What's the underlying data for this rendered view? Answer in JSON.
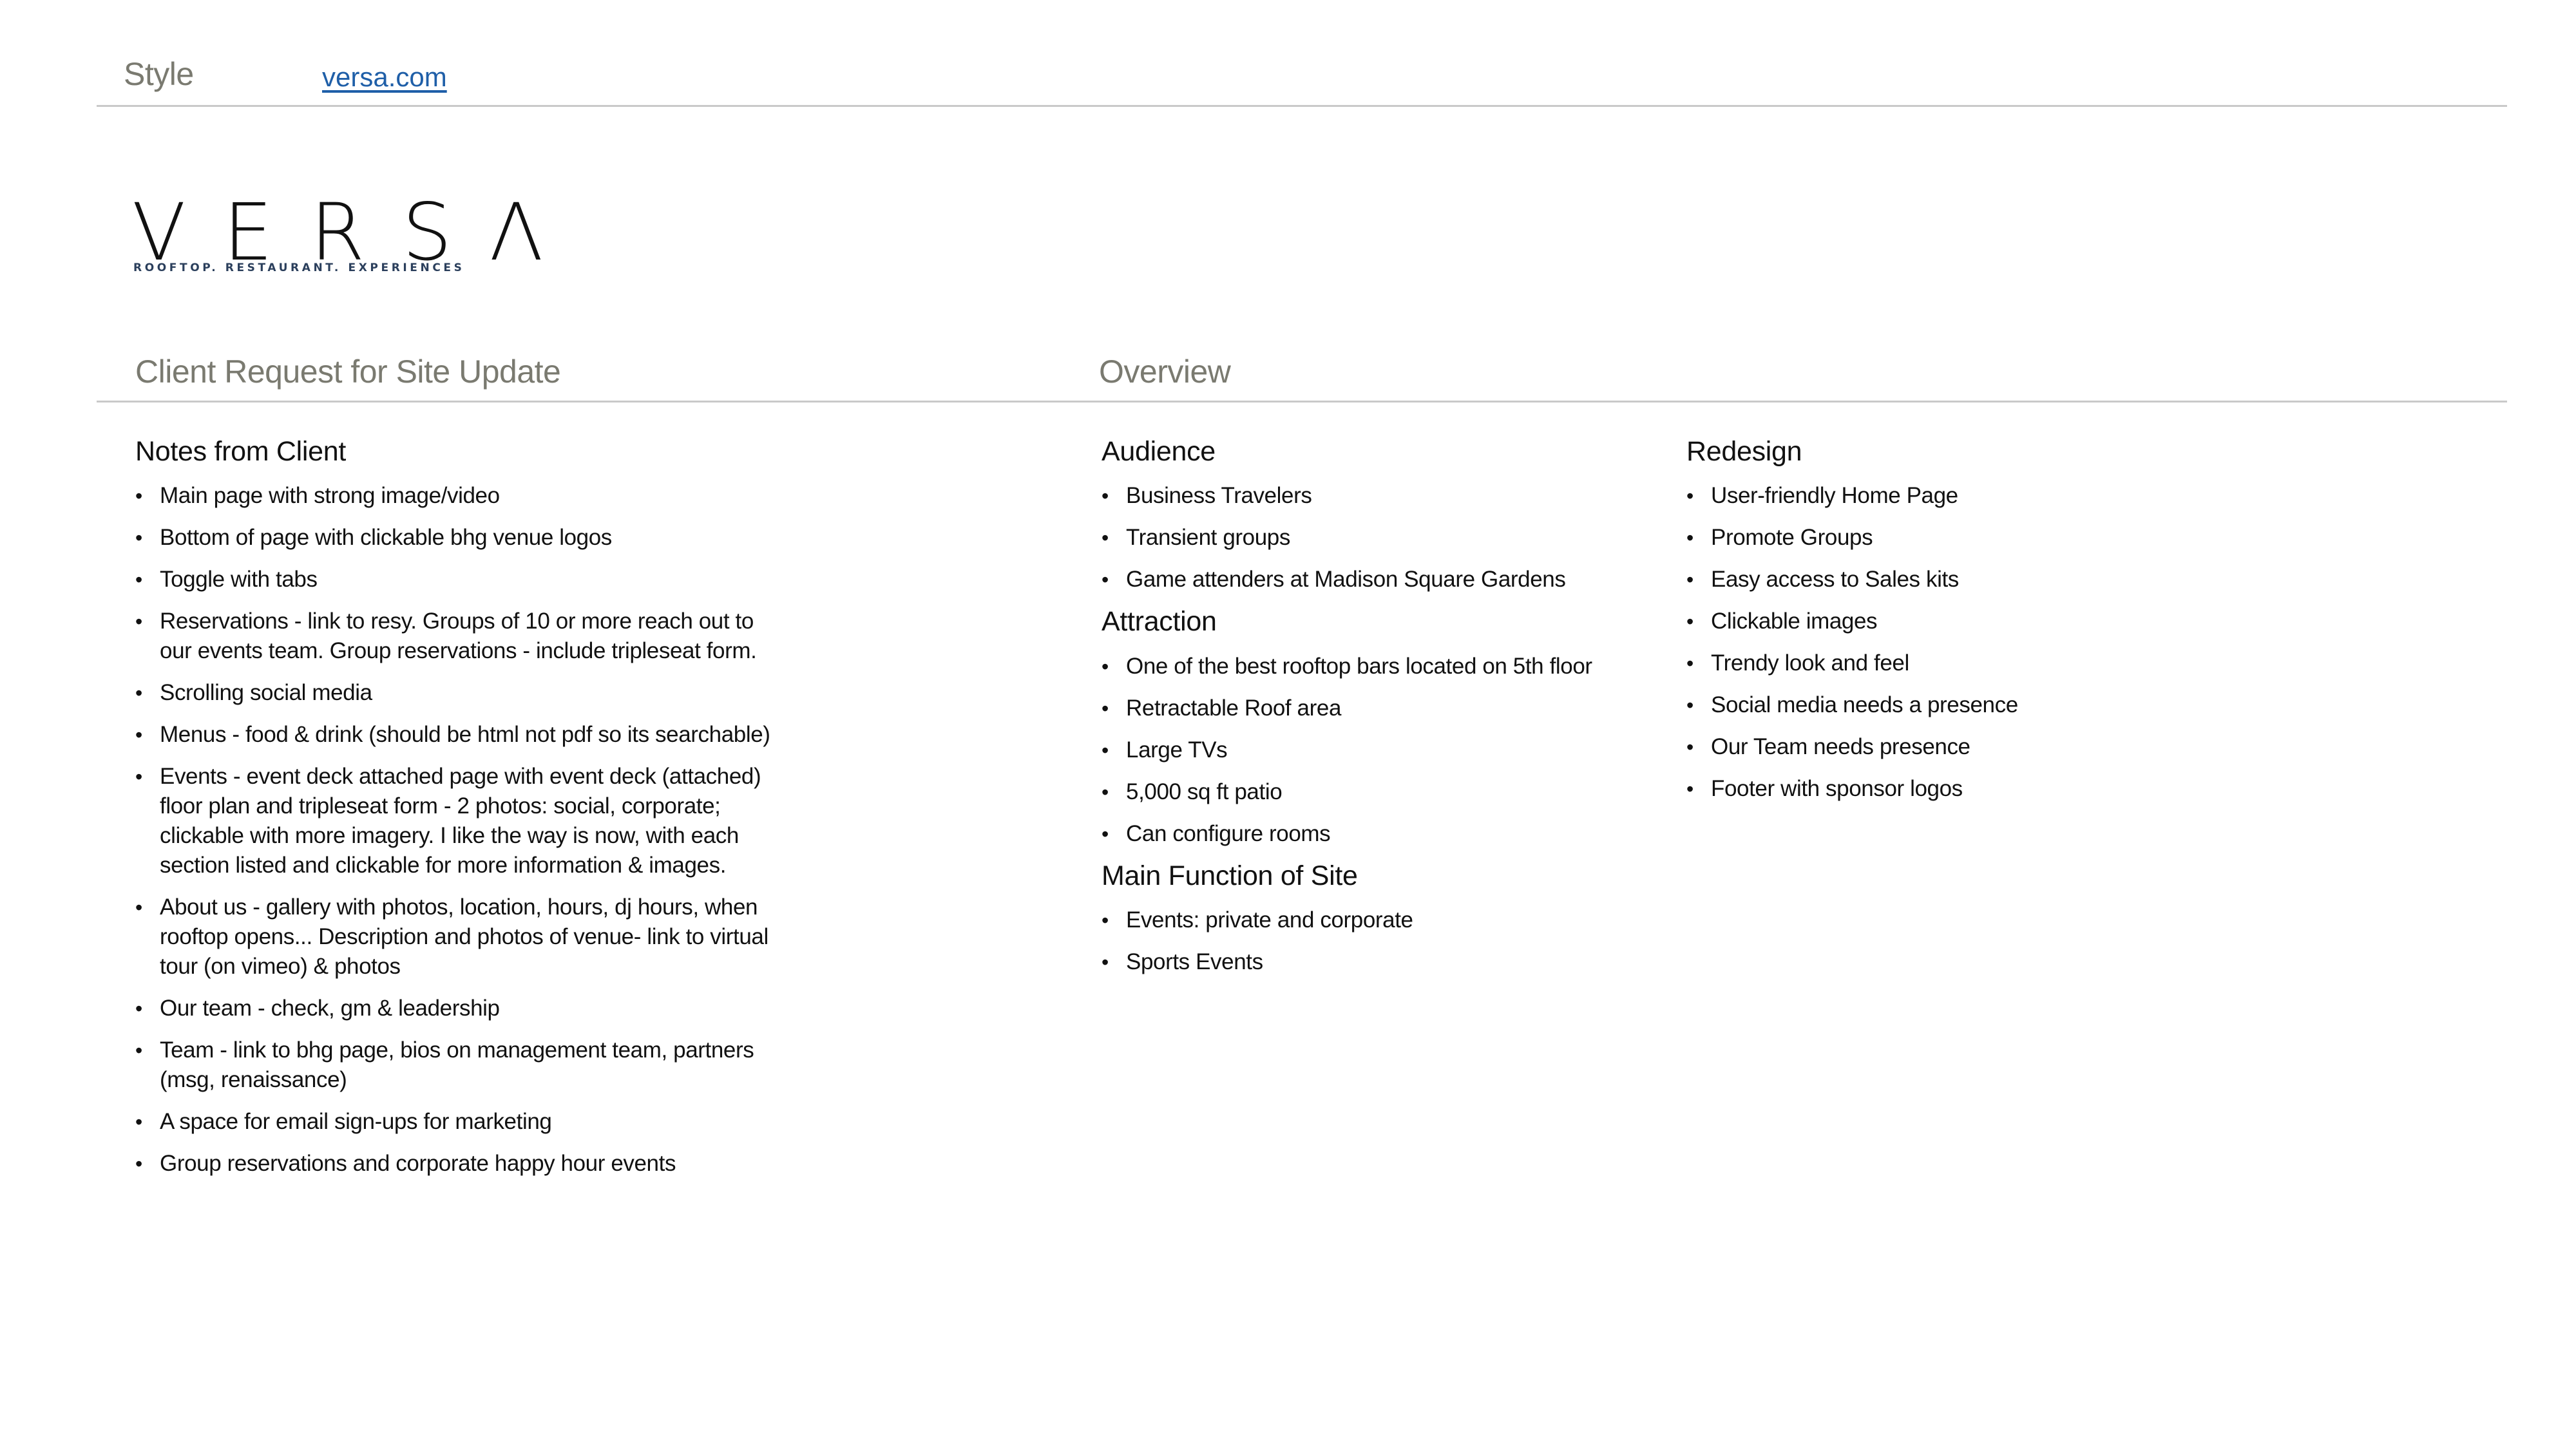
{
  "header": {
    "style_label": "Style",
    "site_link": "versa.com",
    "link_color": "#1f5fa8"
  },
  "logo": {
    "wordmark": "VERSΛ",
    "tagline": "ROOFTOP.  RESTAURANT.  EXPERIENCES",
    "tagline_color": "#2b3f5c"
  },
  "sections": {
    "left_title": "Client Request for Site Update",
    "right_title": "Overview"
  },
  "notes": {
    "heading": "Notes from Client",
    "items": [
      "Main page with strong image/video",
      "Bottom of page with clickable bhg venue logos",
      "Toggle with tabs",
      "Reservations - link to resy. Groups of 10 or more reach out to our events team. Group reservations - include tripleseat form.",
      "Scrolling social media",
      "Menus - food & drink (should be html not pdf so its searchable)",
      "Events - event deck attached page with event deck (attached) floor plan and tripleseat form - 2 photos: social, corporate; clickable with more imagery. I like the way is now, with each section listed and clickable for more information & images.",
      "About us - gallery with photos, location, hours, dj hours, when rooftop opens... Description and photos of venue- link to virtual tour (on vimeo) & photos",
      "Our team - check, gm & leadership",
      "Team - link to bhg page, bios on management team, partners (msg, renaissance)",
      "A space for email sign-ups for marketing",
      "Group reservations and corporate happy hour events"
    ]
  },
  "overview": {
    "audience": {
      "heading": "Audience",
      "items": [
        "Business Travelers",
        "Transient groups",
        "Game attenders at Madison Square Gardens"
      ]
    },
    "attraction": {
      "heading": "Attraction",
      "items": [
        "One of the best rooftop bars located on 5th floor",
        "Retractable Roof area",
        "Large TVs",
        "5,000 sq ft patio",
        "Can configure rooms"
      ]
    },
    "main_function": {
      "heading": "Main Function of Site",
      "items": [
        "Events: private and corporate",
        "Sports Events"
      ]
    },
    "redesign": {
      "heading": "Redesign",
      "items": [
        "User-friendly Home Page",
        "Promote Groups",
        "Easy access to Sales kits",
        "Clickable images",
        "Trendy look and feel",
        "Social media needs a presence",
        "Our Team needs presence",
        "Footer with sponsor logos"
      ]
    }
  },
  "bullet_glyph": "•"
}
